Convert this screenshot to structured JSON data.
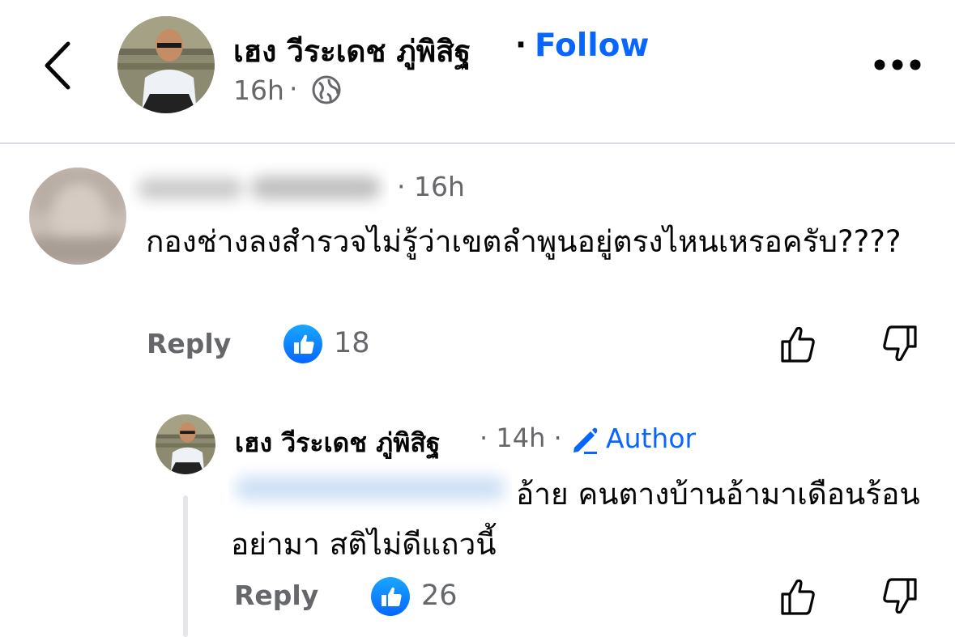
{
  "header": {
    "author_name": "เฮง วีระเดช ภู่พิสิฐ",
    "separator": "·",
    "follow_label": "Follow",
    "time": "16h",
    "time_separator": "·",
    "audience_icon": "globe-icon"
  },
  "comment": {
    "author_name_visible": "",
    "time": "· 16h",
    "text": "กองช่างลงสำรวจไม่รู้ว่าเขตลำพูนอยู่ตรงไหนเหรอครับ????",
    "reply_label": "Reply",
    "like_count": "18"
  },
  "reply": {
    "author_name": "เฮง วีระเดช ภู่พิสิฐ",
    "meta": "· 14h ·",
    "author_badge": "Author",
    "text": "อ้าย คนตางบ้านอ้ามาเดือนร้อน อย่ามา สติไม่ดีแถวนี้",
    "reply_label": "Reply",
    "like_count": "26"
  },
  "colors": {
    "accent": "#0866ff",
    "secondary_text": "#65676b",
    "divider": "#dadde1"
  }
}
